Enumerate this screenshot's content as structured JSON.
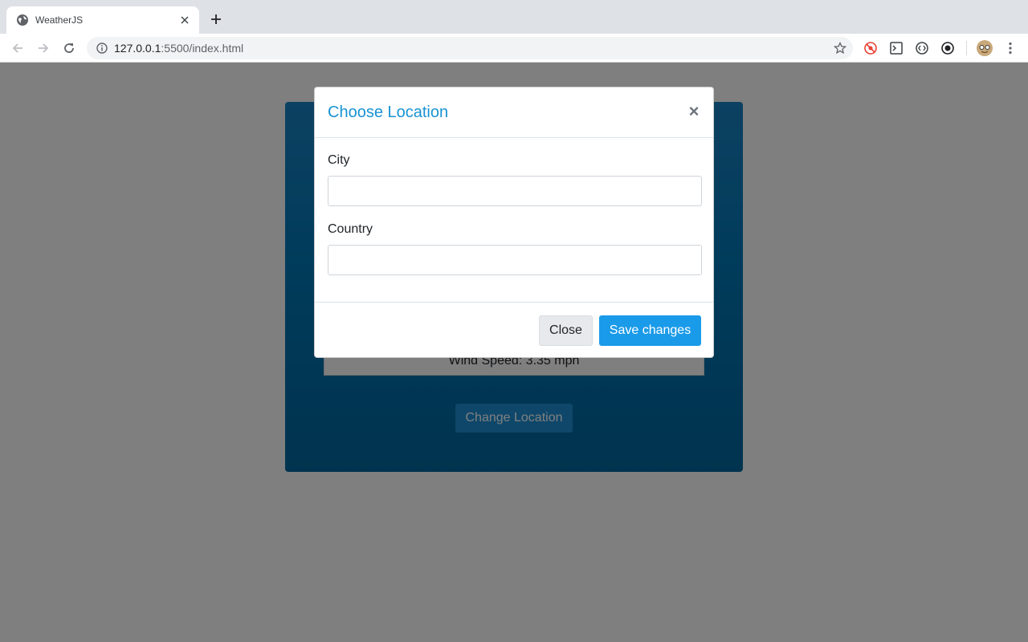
{
  "browser": {
    "tab_title": "WeatherJS",
    "url_host": "127.0.0.1",
    "url_path": ":5500/index.html"
  },
  "page": {
    "wind_speed_text": "Wind Speed: 3.35 mph",
    "change_location_label": "Change Location"
  },
  "modal": {
    "title": "Choose Location",
    "close_symbol": "×",
    "city_label": "City",
    "city_value": "",
    "country_label": "Country",
    "country_value": "",
    "close_button_label": "Close",
    "save_button_label": "Save changes"
  },
  "colors": {
    "title_color": "#1893d3",
    "primary_button": "#1a9be9",
    "card_blue": "#0077b6"
  }
}
